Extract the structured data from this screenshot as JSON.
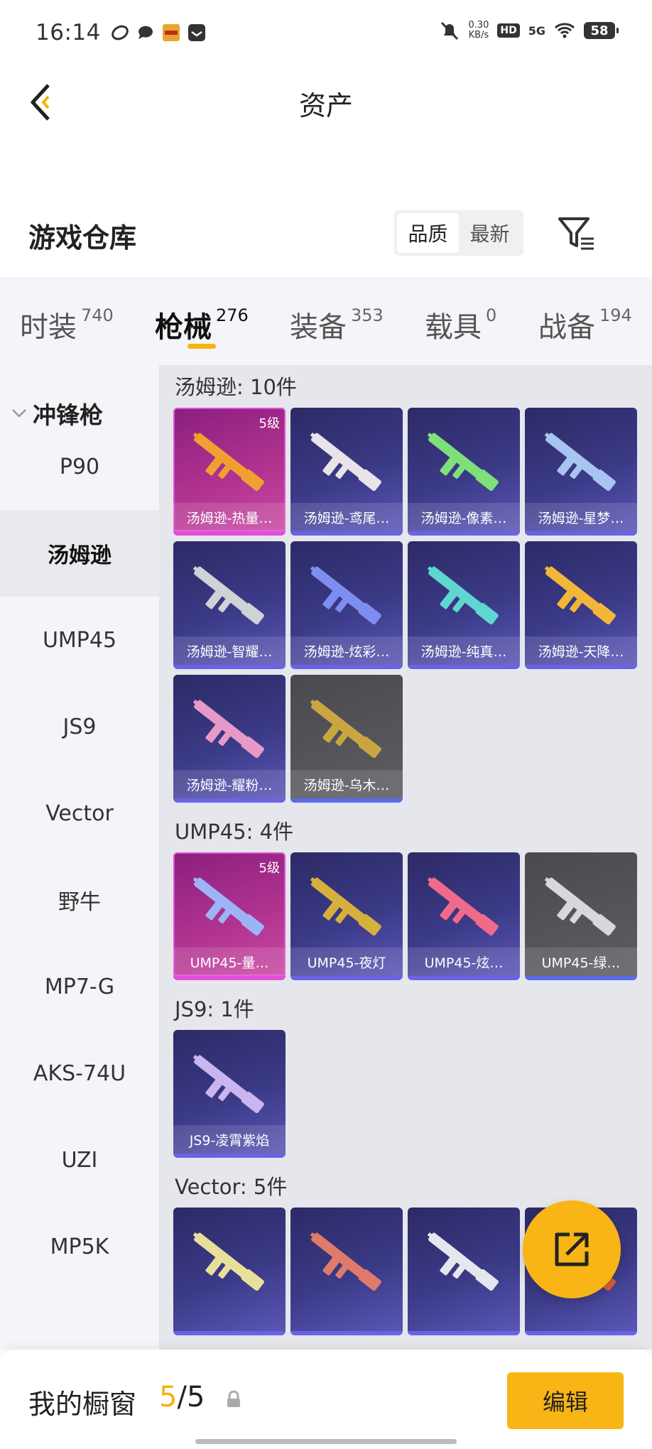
{
  "status_bar": {
    "time": "16:14",
    "net_speed_value": "0.30",
    "net_speed_unit": "KB/s",
    "hd": "HD",
    "network": "5G",
    "battery": "58"
  },
  "header": {
    "title": "资产"
  },
  "warehouse": {
    "title": "游戏仓库",
    "sort_options": [
      "品质",
      "最新"
    ],
    "sort_selected": "品质"
  },
  "tabs": [
    {
      "label": "时装",
      "count": "740"
    },
    {
      "label": "枪械",
      "count": "276",
      "active": true
    },
    {
      "label": "装备",
      "count": "353"
    },
    {
      "label": "载具",
      "count": "0"
    },
    {
      "label": "战备",
      "count": "194"
    }
  ],
  "sidebar": {
    "group": "冲锋枪",
    "items": [
      "P90",
      "汤姆逊",
      "UMP45",
      "JS9",
      "Vector",
      "野牛",
      "MP7-G",
      "AKS-74U",
      "UZI",
      "MP5K"
    ],
    "selected": "汤姆逊"
  },
  "sections": [
    {
      "title": "汤姆逊: 10件",
      "items": [
        {
          "name": "汤姆逊-热量…",
          "level": "5级",
          "rarity": "legend",
          "color": "#f0a030"
        },
        {
          "name": "汤姆逊-鸢尾…",
          "rarity": "epic",
          "color": "#e8e4ea"
        },
        {
          "name": "汤姆逊-像素…",
          "rarity": "epic",
          "color": "#7ee07a"
        },
        {
          "name": "汤姆逊-星梦…",
          "rarity": "epic",
          "color": "#a8c4f0"
        },
        {
          "name": "汤姆逊-智耀…",
          "rarity": "epic",
          "color": "#cfd2d6"
        },
        {
          "name": "汤姆逊-炫彩…",
          "rarity": "epic",
          "color": "#7d8ef0"
        },
        {
          "name": "汤姆逊-纯真…",
          "rarity": "epic",
          "color": "#5fd6d0"
        },
        {
          "name": "汤姆逊-天降…",
          "rarity": "epic",
          "color": "#f2b63a"
        },
        {
          "name": "汤姆逊-耀粉…",
          "rarity": "epic",
          "color": "#e79ac8"
        },
        {
          "name": "汤姆逊-乌木…",
          "rarity": "grey",
          "color": "#c9a640"
        }
      ]
    },
    {
      "title": "UMP45: 4件",
      "items": [
        {
          "name": "UMP45-量…",
          "level": "5级",
          "rarity": "legend",
          "color": "#9cb4f5"
        },
        {
          "name": "UMP45-夜灯",
          "rarity": "epic",
          "color": "#d6b03c"
        },
        {
          "name": "UMP45-炫…",
          "rarity": "epic",
          "color": "#f06a8c"
        },
        {
          "name": "UMP45-绿…",
          "rarity": "grey",
          "color": "#d8d8dc"
        }
      ]
    },
    {
      "title": "JS9: 1件",
      "items": [
        {
          "name": "JS9-凌霄紫焰",
          "rarity": "epic",
          "color": "#c9b6f0"
        }
      ]
    },
    {
      "title": "Vector: 5件",
      "items": [
        {
          "name": "",
          "rarity": "epic",
          "color": "#e8e09a"
        },
        {
          "name": "",
          "rarity": "epic",
          "color": "#e07a6a"
        },
        {
          "name": "",
          "rarity": "epic",
          "color": "#e6e6ee"
        },
        {
          "name": "",
          "rarity": "epic",
          "color": "#e0603a"
        }
      ]
    }
  ],
  "bottom": {
    "showcase_label": "我的橱窗",
    "current": "5",
    "separator": "/",
    "total": "5",
    "edit_label": "编辑"
  },
  "icons": [
    "back-icon",
    "filter-icon",
    "share-icon",
    "lock-icon",
    "chevron-down-icon"
  ]
}
